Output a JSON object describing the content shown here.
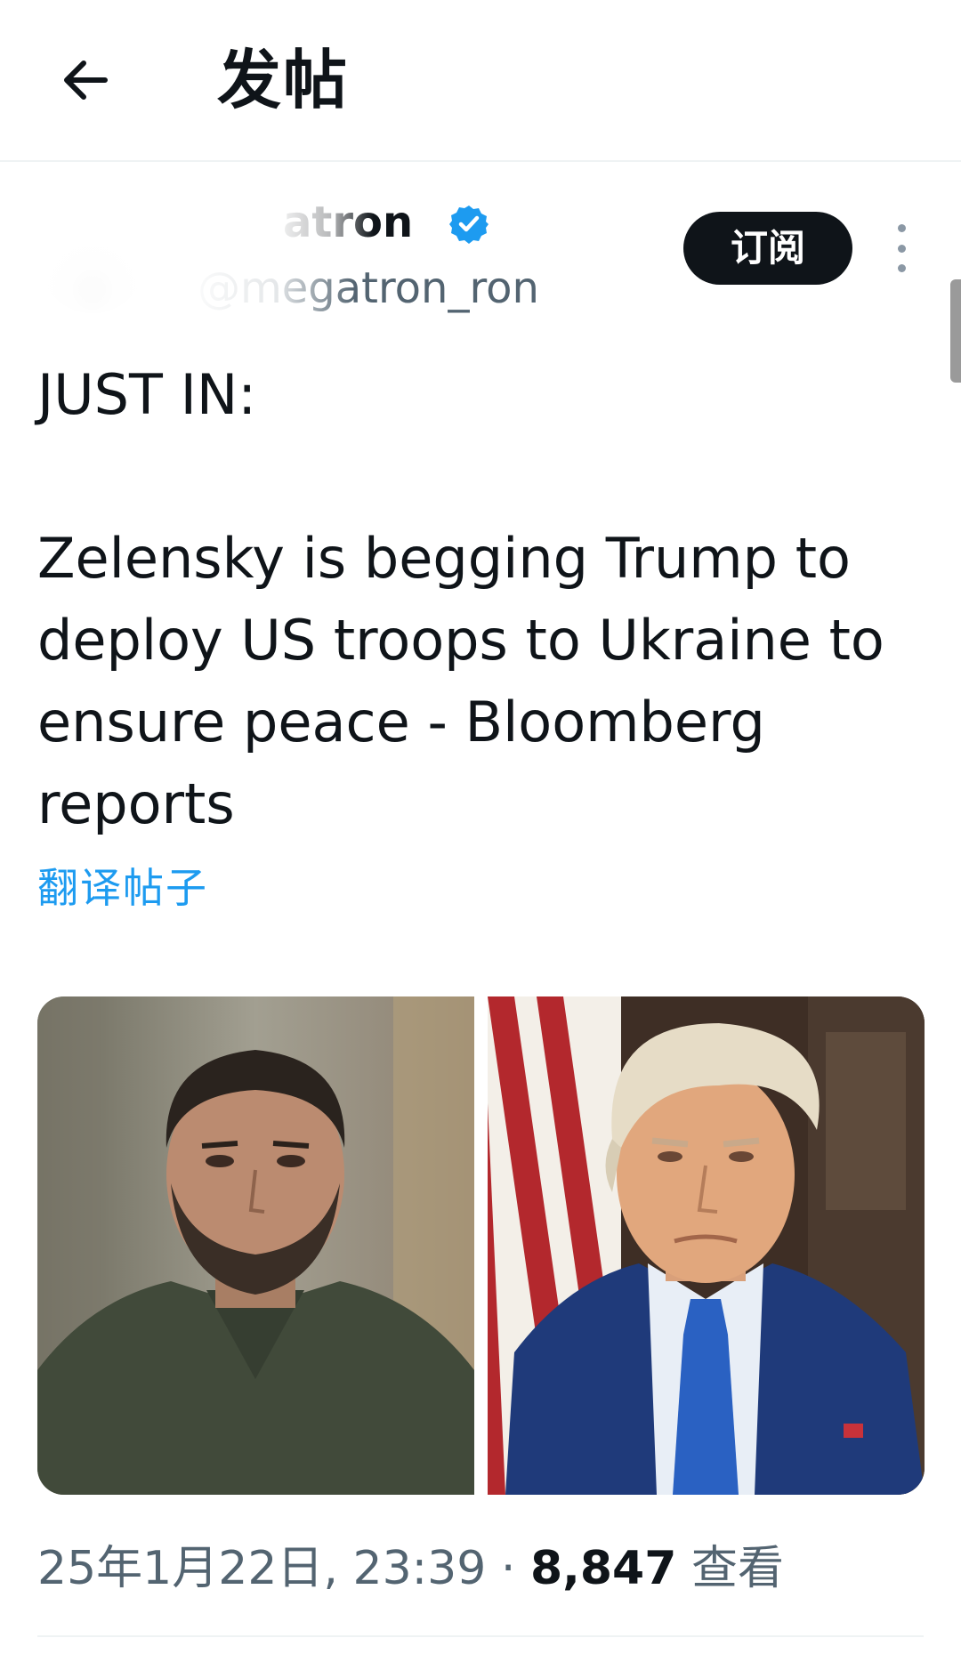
{
  "header": {
    "title": "发帖",
    "back_icon": "arrow-left-icon"
  },
  "author": {
    "display_name": "atron",
    "handle": "@megatron_ron",
    "verified_color": "#1d9bf0",
    "subscribe_label": "订阅",
    "more_icon": "more-vertical-icon"
  },
  "post": {
    "text": "JUST IN:\n\nZelensky is begging Trump to deploy US troops to Ukraine to ensure peace - Bloomberg reports",
    "translate_label": "翻译帖子"
  },
  "media": {
    "images": [
      {
        "name": "photo-zelensky"
      },
      {
        "name": "photo-trump"
      }
    ]
  },
  "meta": {
    "timestamp": "25年1月22日, 23:39",
    "separator": "·",
    "views_count": "8,847",
    "views_label": "查看"
  },
  "colors": {
    "accent": "#1d9bf0",
    "text_primary": "#0f1419",
    "text_secondary": "#536471"
  }
}
